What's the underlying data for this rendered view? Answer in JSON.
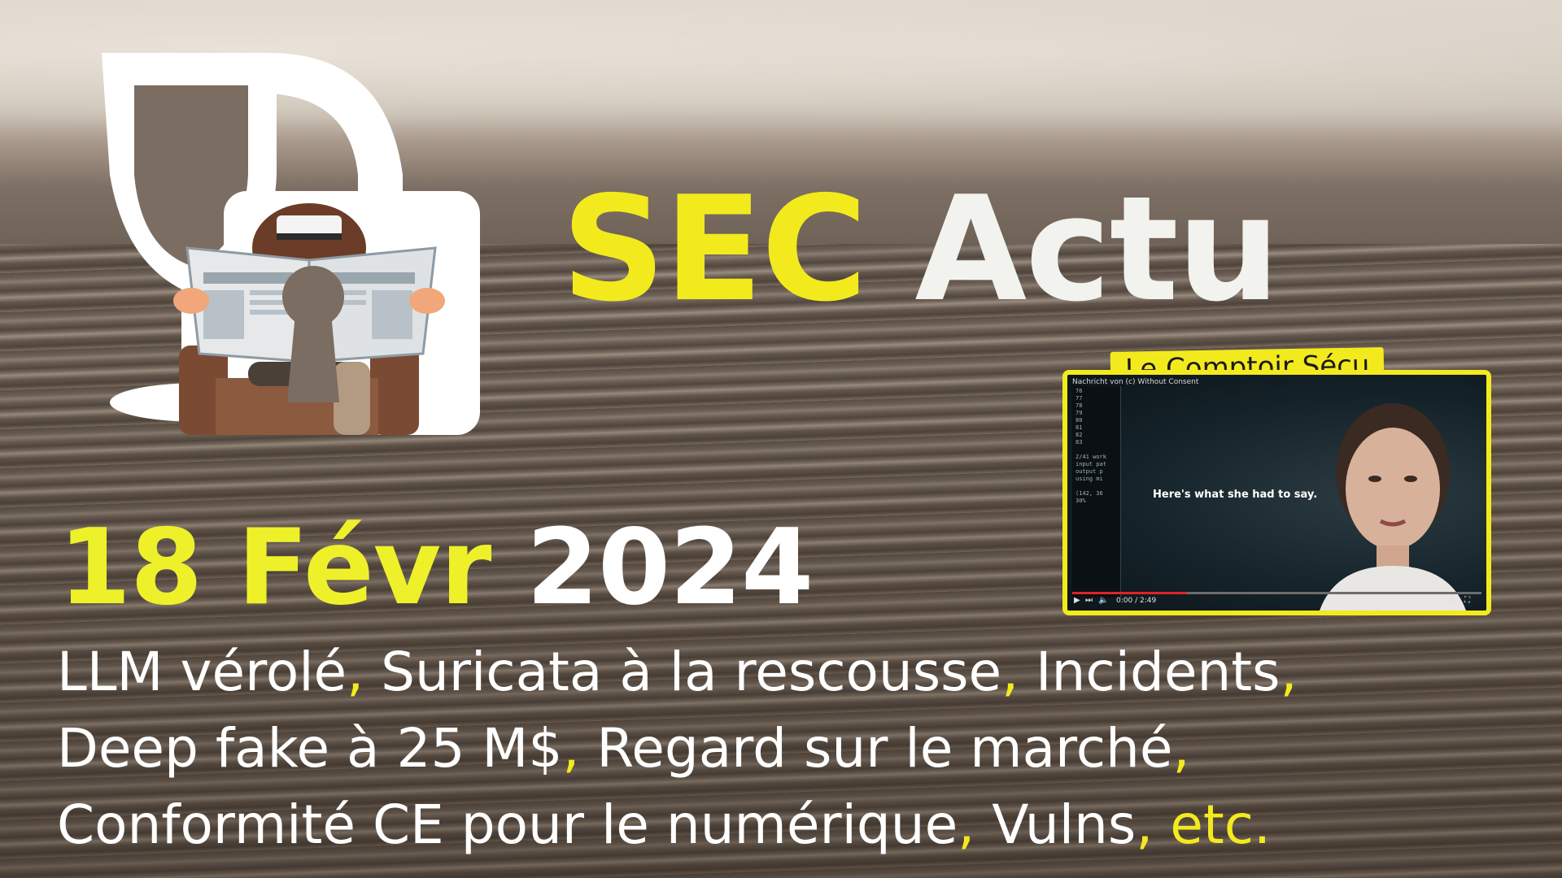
{
  "title": {
    "part1": "SEC",
    "part2": "Actu"
  },
  "date": {
    "day_month": "18 Févr",
    "year": "2024"
  },
  "subtitle": {
    "line1": [
      "LLM vérolé",
      ", ",
      "Suricata à la rescousse",
      ", ",
      "Incidents",
      ","
    ],
    "line2": [
      "Deep fake à 25 M$",
      ", ",
      "Regard sur le marché",
      ","
    ],
    "line3": [
      "Conformité CE pour le numérique",
      ", ",
      "Vulns",
      ", ",
      "etc."
    ]
  },
  "video": {
    "label": "Le Comptoir Sécu",
    "topbar_text": "Nachricht von (c) Without Consent",
    "caption": "Here's what she had to say.",
    "terminal_lines": [
      "76",
      "77",
      "78",
      "79",
      "80",
      "81",
      "82",
      "83",
      "",
      "2/41 work",
      "input pat",
      "output p",
      "using mi",
      "",
      "(142, 36",
      "30%"
    ],
    "time": "0:00 / 2:49",
    "progress": 0.28
  },
  "icons": {
    "logo": "wine-glass-padlock-newspaper-reader-logo",
    "play": "play-icon",
    "next": "next-icon",
    "volume": "volume-icon",
    "settings": "settings-icon",
    "fullscreen": "fullscreen-icon"
  },
  "colors": {
    "accent_yellow": "#f3ea1e",
    "text_white": "#ffffff",
    "progress_red": "#e02424"
  }
}
